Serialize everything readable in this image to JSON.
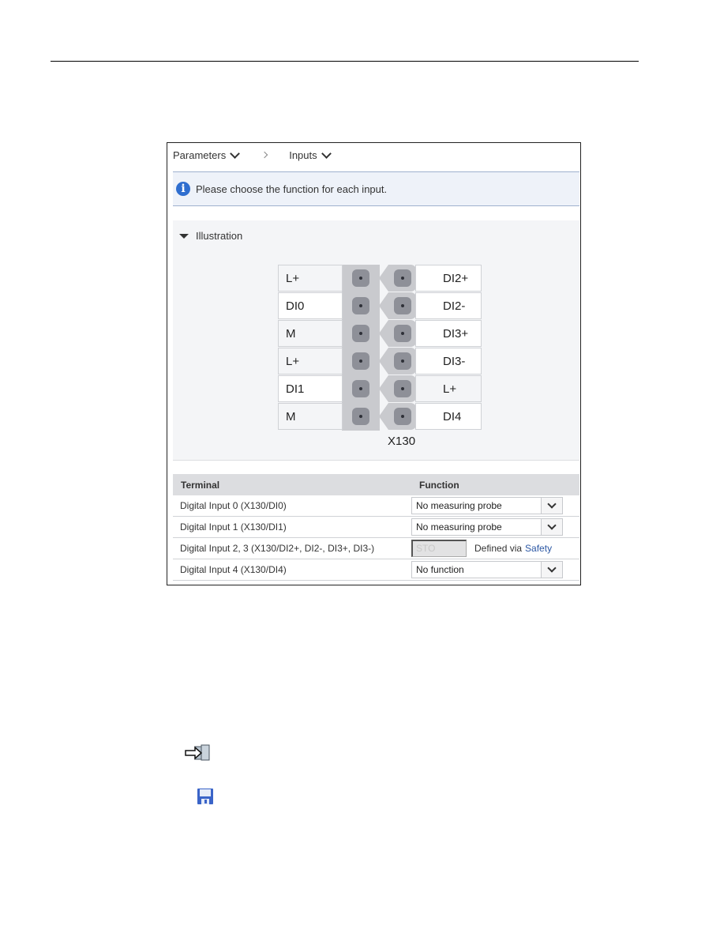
{
  "breadcrumb": {
    "items": [
      {
        "label": "Parameters",
        "icon": "chevron-down-icon"
      },
      {
        "label": "Inputs",
        "icon": "chevron-down-icon"
      }
    ],
    "separator_icon": "chevron-right-icon"
  },
  "info": {
    "icon": "info-icon",
    "icon_glyph": "i",
    "text": "Please choose the function for each input."
  },
  "illustration": {
    "title": "Illustration",
    "toggle_icon": "triangle-down-icon",
    "connector_label": "X130",
    "left_terminals": [
      "L+",
      "DI0",
      "M",
      "L+",
      "DI1",
      "M"
    ],
    "right_terminals": [
      "DI2+",
      "DI2-",
      "DI3+",
      "DI3-",
      "L+",
      "DI4"
    ]
  },
  "table": {
    "headers": {
      "terminal": "Terminal",
      "function": "Function"
    },
    "rows": [
      {
        "terminal": "Digital Input 0 (X130/DI0)",
        "type": "select",
        "value": "No measuring probe"
      },
      {
        "terminal": "Digital Input 1 (X130/DI1)",
        "type": "select",
        "value": "No measuring probe"
      },
      {
        "terminal": "Digital Input 2, 3 (X130/DI2+, DI2-, DI3+, DI3-)",
        "type": "safety",
        "value": "STO",
        "note": "Defined via",
        "link": "Safety"
      },
      {
        "terminal": "Digital Input 4 (X130/DI4)",
        "type": "select",
        "value": "No function"
      }
    ]
  },
  "page_icons": [
    {
      "name": "goto-icon"
    },
    {
      "name": "save-icon",
      "color": "#3a64c8"
    }
  ],
  "colors": {
    "info_bg": "#eef2f9",
    "info_icon": "#2f6ecf",
    "link": "#2b57a4",
    "connector_body": "#c9cace",
    "pin": "#8e9098"
  }
}
